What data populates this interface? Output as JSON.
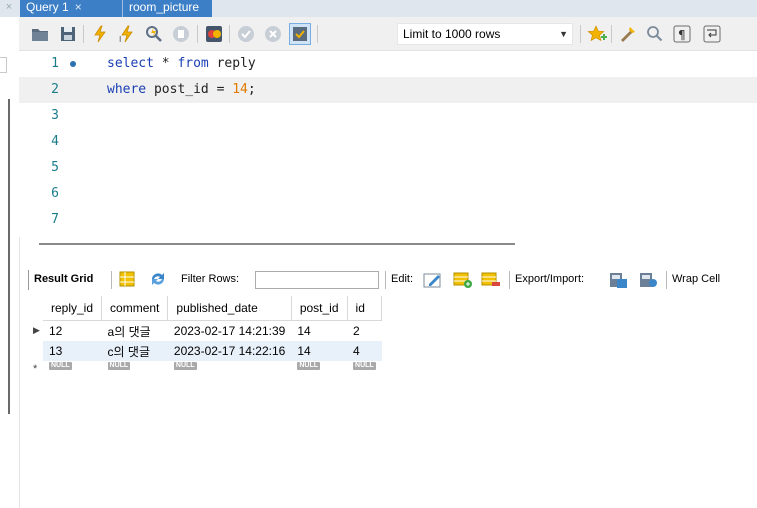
{
  "tabs": [
    {
      "label": "Query 1",
      "close": "×",
      "active": true
    },
    {
      "label": "room_picture",
      "active": false
    }
  ],
  "toolbar": {
    "icons": [
      "open-folder-icon",
      "save-icon",
      "execute-icon",
      "execute-selection-icon",
      "explain-icon",
      "stop-icon",
      "toggle-error-icon",
      "commit-icon",
      "rollback-icon",
      "autocommit-icon",
      "beautify-icon",
      "find-icon",
      "invisible-chars-icon",
      "wrap-icon",
      "bookmark-icon"
    ],
    "limit_label": "Limit to 1000 rows"
  },
  "editor": {
    "lines": [
      {
        "n": "1",
        "code": "select * from reply"
      },
      {
        "n": "2",
        "code": "where post_id = 14;"
      },
      {
        "n": "3",
        "code": ""
      },
      {
        "n": "4",
        "code": ""
      },
      {
        "n": "5",
        "code": ""
      },
      {
        "n": "6",
        "code": ""
      },
      {
        "n": "7",
        "code": ""
      }
    ]
  },
  "result_toolbar": {
    "result_grid": "Result Grid",
    "filter_rows": "Filter Rows:",
    "edit": "Edit:",
    "export_import": "Export/Import:",
    "wrap_cell": "Wrap Cell"
  },
  "grid": {
    "columns": [
      "reply_id",
      "comment",
      "published_date",
      "post_id",
      "id"
    ],
    "rows": [
      [
        "12",
        "a의 댓글",
        "2023-02-17 14:21:39",
        "14",
        "2"
      ],
      [
        "13",
        "c의 댓글",
        "2023-02-17 14:22:16",
        "14",
        "4"
      ]
    ],
    "null_label": "NULL",
    "new_row_marker": "*",
    "current_row_marker": "▶"
  }
}
